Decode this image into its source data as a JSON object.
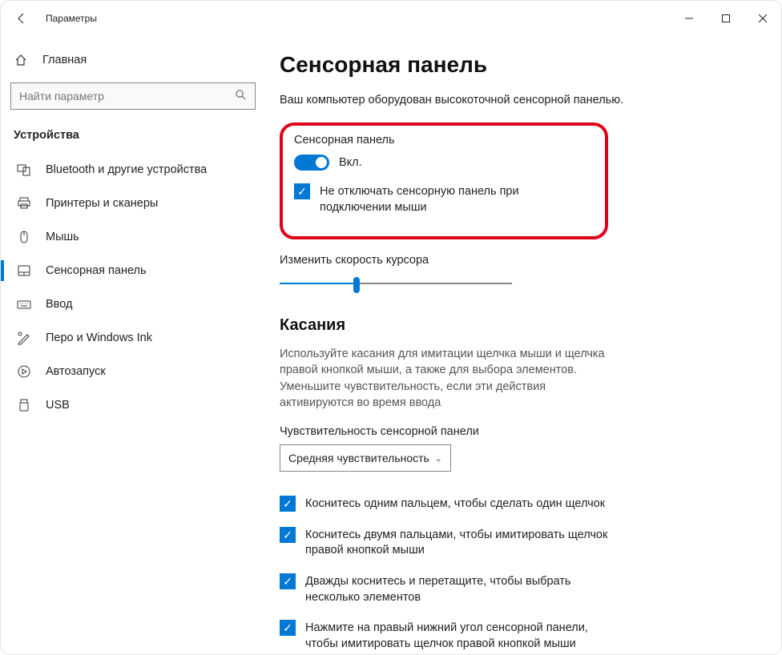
{
  "titlebar": {
    "back_tooltip": "Назад",
    "app_title": "Параметры"
  },
  "sidebar": {
    "home_label": "Главная",
    "search_placeholder": "Найти параметр",
    "section_label": "Устройства",
    "items": [
      {
        "label": "Bluetooth и другие устройства"
      },
      {
        "label": "Принтеры и сканеры"
      },
      {
        "label": "Мышь"
      },
      {
        "label": "Сенсорная панель"
      },
      {
        "label": "Ввод"
      },
      {
        "label": "Перо и Windows Ink"
      },
      {
        "label": "Автозапуск"
      },
      {
        "label": "USB"
      }
    ]
  },
  "main": {
    "title": "Сенсорная панель",
    "subtitle": "Ваш компьютер оборудован высокоточной сенсорной панелью.",
    "group_label": "Сенсорная панель",
    "toggle_state": "Вкл.",
    "keep_on_mouse": "Не отключать сенсорную панель при подключении мыши",
    "speed_label": "Изменить скорость курсора",
    "touches_heading": "Касания",
    "touches_desc": "Используйте касания для имитации щелчка мыши и щелчка правой кнопкой мыши, а также для выбора элементов. Уменьшите чувствительность, если эти действия активируются во время ввода",
    "sensitivity_label": "Чувствительность сенсорной панели",
    "sensitivity_value": "Средняя чувствительность",
    "checks": [
      "Коснитесь одним пальцем, чтобы сделать один щелчок",
      "Коснитесь двумя пальцами, чтобы имитировать щелчок правой кнопкой мыши",
      "Дважды коснитесь и перетащите, чтобы выбрать несколько элементов",
      "Нажмите на правый нижний угол сенсорной панели, чтобы имитировать щелчок правой кнопкой мыши"
    ]
  }
}
